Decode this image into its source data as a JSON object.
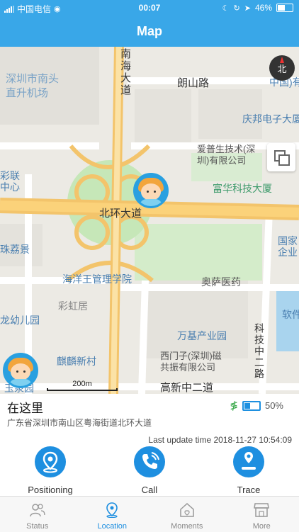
{
  "status_bar": {
    "carrier": "中国电信",
    "time": "00:07",
    "battery": "46%"
  },
  "header": {
    "title": "Map"
  },
  "map": {
    "labels": {
      "place_1": "深圳市南头",
      "place_2": "直升机场",
      "road_north": "南海大道",
      "road_langshan": "朗山路",
      "zhongguo": "中国)有",
      "qingbang": "庆邦电子大厦",
      "aipusheng_1": "爱普生技术(深",
      "aipusheng_2": "圳)有限公司",
      "fuhua": "富华科技大厦",
      "cailian_1": "彩联",
      "cailian_2": "中心",
      "beihuan": "北环大道",
      "zhulijing": "珠荔景",
      "guojia_1": "国家",
      "guojia_2": "企业",
      "haiyangwang": "海洋王管理学院",
      "aosa": "奥萨医药",
      "caihongju": "彩虹居",
      "youeryuan": "龙幼儿园",
      "ruanjian": "软件",
      "wanji": "万基产业园",
      "kejizhong": "科技中二路",
      "qilinxincun": "麒麟新村",
      "ximenzi_1": "西门子(深圳)磁",
      "ximenzi_2": "共振有限公司",
      "gaoxin": "高新中二道",
      "yujinyuan": "玉泉园"
    },
    "compass": "北",
    "scale": "200m"
  },
  "info": {
    "place_title": "在这里",
    "address": "广东省深圳市南山区粤海街道北环大道",
    "device_battery": "50%",
    "last_update": "Last update time 2018-11-27 10:54:09"
  },
  "actions": [
    {
      "label": "Positioning",
      "icon": "location-pin-icon"
    },
    {
      "label": "Call",
      "icon": "phone-icon"
    },
    {
      "label": "Trace",
      "icon": "trace-icon"
    }
  ],
  "tabs": [
    {
      "label": "Status",
      "icon": "people-icon"
    },
    {
      "label": "Location",
      "icon": "location-icon"
    },
    {
      "label": "Moments",
      "icon": "home-icon"
    },
    {
      "label": "More",
      "icon": "store-icon"
    }
  ],
  "colors": {
    "header": "#39a7e8",
    "accent": "#1e8fe0",
    "road_main": "#f3c46b",
    "green": "#bfe3b0"
  }
}
